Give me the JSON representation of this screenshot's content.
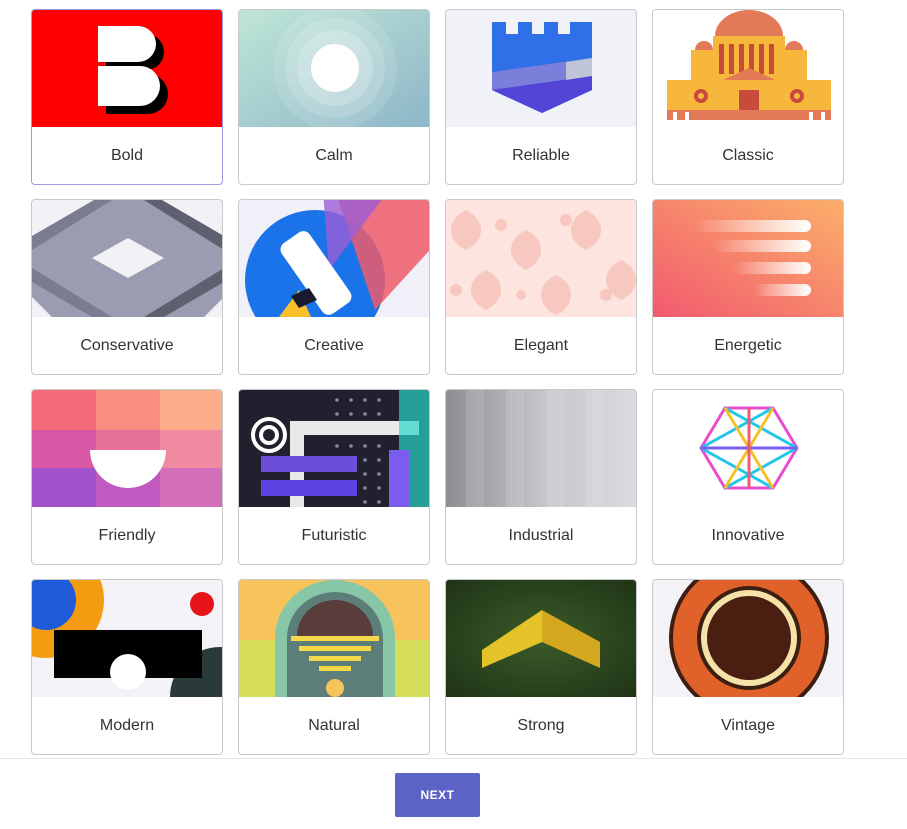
{
  "styles": [
    {
      "label": "Bold",
      "icon": "bold-b-icon",
      "selected": true
    },
    {
      "label": "Calm",
      "icon": "calm-circle-icon"
    },
    {
      "label": "Reliable",
      "icon": "castle-tower-icon"
    },
    {
      "label": "Classic",
      "icon": "palace-building-icon"
    },
    {
      "label": "Conservative",
      "icon": "grey-chevron-pattern-icon"
    },
    {
      "label": "Creative",
      "icon": "paint-roller-icon"
    },
    {
      "label": "Elegant",
      "icon": "damask-pattern-icon"
    },
    {
      "label": "Energetic",
      "icon": "speed-lines-icon"
    },
    {
      "label": "Friendly",
      "icon": "half-circle-grid-icon"
    },
    {
      "label": "Futuristic",
      "icon": "tech-grid-icon"
    },
    {
      "label": "Industrial",
      "icon": "metal-gradient-icon"
    },
    {
      "label": "Innovative",
      "icon": "hexagon-lines-icon"
    },
    {
      "label": "Modern",
      "icon": "geometric-shapes-icon"
    },
    {
      "label": "Natural",
      "icon": "landscape-arch-icon"
    },
    {
      "label": "Strong",
      "icon": "chevron-arrow-icon"
    },
    {
      "label": "Vintage",
      "icon": "concentric-rings-icon"
    }
  ],
  "footer": {
    "next_label": "NEXT"
  },
  "colors": {
    "accent": "#5b64c6",
    "selected_border": "#9b9be0"
  }
}
